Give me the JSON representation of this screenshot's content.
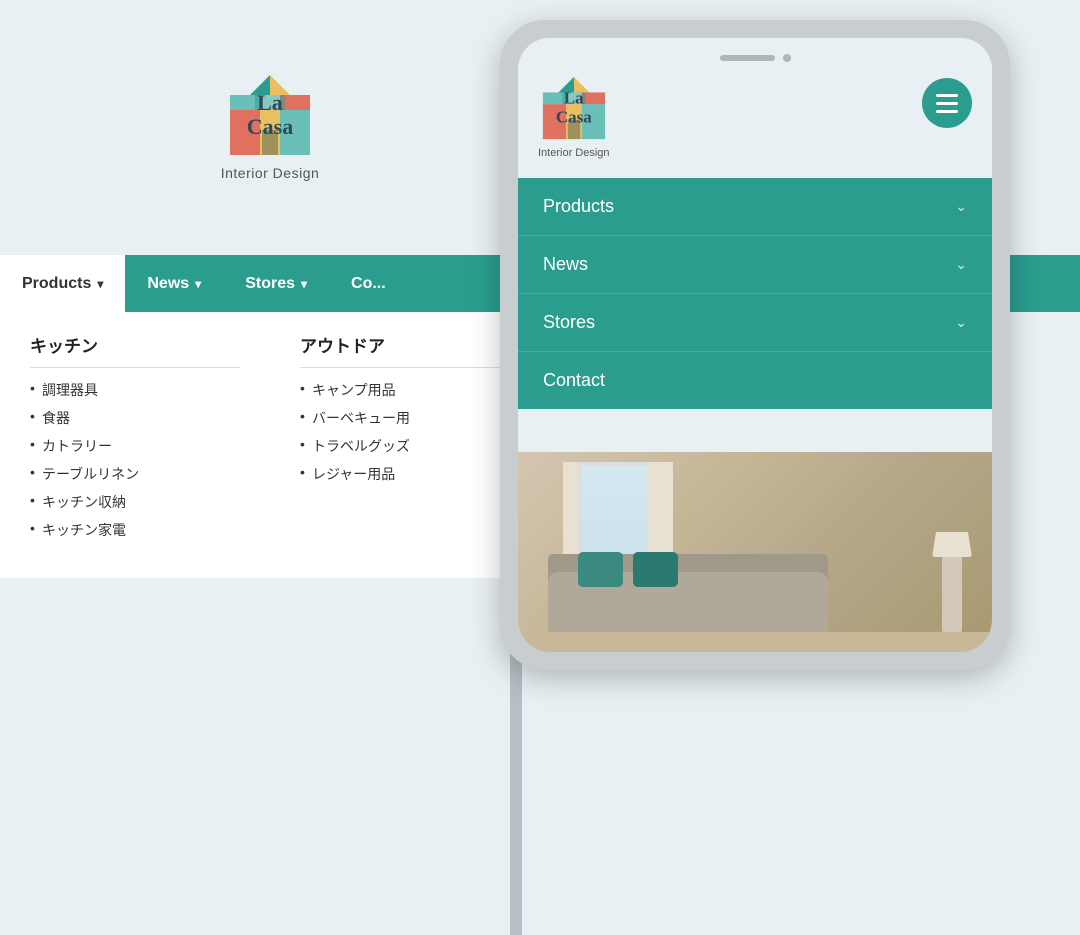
{
  "brand": {
    "name_line1": "La",
    "name_line2": "Casa",
    "subtitle": "Interior Design"
  },
  "desktop_nav": {
    "items": [
      {
        "label": "Products",
        "has_chevron": true,
        "active": true
      },
      {
        "label": "News",
        "has_chevron": true,
        "active": false
      },
      {
        "label": "Stores",
        "has_chevron": true,
        "active": false
      },
      {
        "label": "Co...",
        "has_chevron": false,
        "active": false
      }
    ]
  },
  "dropdown": {
    "columns": [
      {
        "heading": "キッチン",
        "items": [
          "調理器具",
          "食器",
          "カトラリー",
          "テーブルリネン",
          "キッチン収納",
          "キッチン家電"
        ]
      },
      {
        "heading": "アウトドア",
        "items": [
          "キャンプ用品",
          "バーベキュー用",
          "トラベルグッズ",
          "レジャー用品"
        ]
      }
    ]
  },
  "mobile_menu": {
    "items": [
      {
        "label": "Products",
        "has_chevron": true
      },
      {
        "label": "News",
        "has_chevron": true
      },
      {
        "label": "Stores",
        "has_chevron": true
      },
      {
        "label": "Contact",
        "has_chevron": false
      }
    ]
  },
  "hamburger": {
    "aria_label": "Menu"
  }
}
